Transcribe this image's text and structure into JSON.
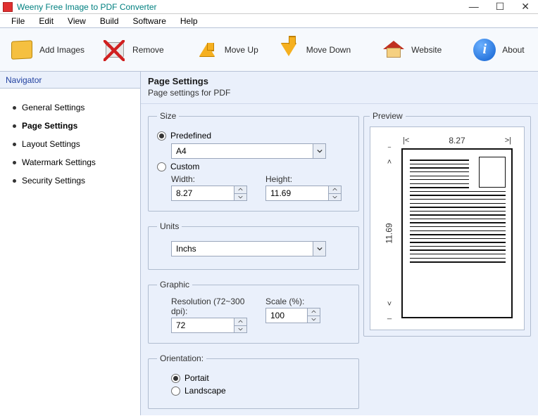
{
  "app": {
    "title": "Weeny Free Image to PDF Converter"
  },
  "menu": [
    "File",
    "Edit",
    "View",
    "Build",
    "Software",
    "Help"
  ],
  "toolbar": {
    "add": "Add Images",
    "remove": "Remove",
    "moveup": "Move Up",
    "movedown": "Move Down",
    "website": "Website",
    "about": "About"
  },
  "navigator": {
    "title": "Navigator",
    "items": [
      {
        "label": "General Settings",
        "active": false
      },
      {
        "label": "Page Settings",
        "active": true
      },
      {
        "label": "Layout Settings",
        "active": false
      },
      {
        "label": "Watermark Settings",
        "active": false
      },
      {
        "label": "Security Settings",
        "active": false
      }
    ]
  },
  "page": {
    "title": "Page Settings",
    "subtitle": "Page settings for PDF"
  },
  "size": {
    "legend": "Size",
    "predefined_label": "Predefined",
    "predefined_value": "A4",
    "custom_label": "Custom",
    "width_label": "Width:",
    "width_value": "8.27",
    "height_label": "Height:",
    "height_value": "11.69",
    "selected": "predefined"
  },
  "units": {
    "legend": "Units",
    "value": "Inchs"
  },
  "graphic": {
    "legend": "Graphic",
    "resolution_label": "Resolution (72~300 dpi):",
    "resolution_value": "72",
    "scale_label": "Scale (%):",
    "scale_value": "100"
  },
  "orientation": {
    "legend": "Orientation:",
    "portrait_label": "Portait",
    "landscape_label": "Landscape",
    "selected": "portrait"
  },
  "preview": {
    "legend": "Preview",
    "width": "8.27",
    "height": "11.69",
    "cap_lt": "|<",
    "cap_rt": ">|",
    "cap_tp": "‾",
    "cap_up": "˄",
    "cap_dn": "˅",
    "cap_bt": "_"
  }
}
